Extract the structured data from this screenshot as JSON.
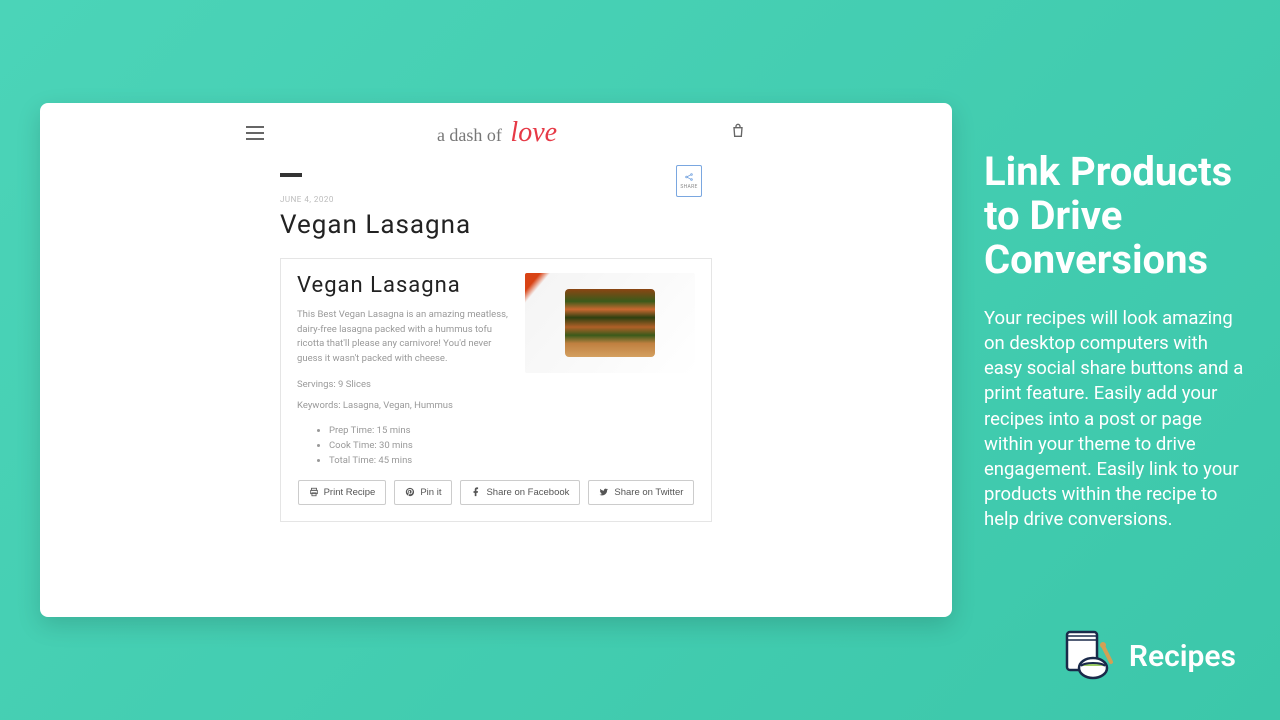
{
  "site": {
    "logo_prefix": "a dash of",
    "logo_accent": "love"
  },
  "post": {
    "date": "JUNE 4, 2020",
    "title": "Vegan Lasagna",
    "share_label": "SHARE"
  },
  "recipe": {
    "title": "Vegan Lasagna",
    "description": "This Best Vegan Lasagna is an amazing meatless, dairy-free lasagna packed with a hummus tofu ricotta that'll please any carnivore! You'd never guess it wasn't packed with cheese.",
    "servings": "Servings: 9 Slices",
    "keywords": "Keywords: Lasagna, Vegan, Hummus",
    "times": [
      "Prep Time: 15 mins",
      "Cook Time: 30 mins",
      "Total Time: 45 mins"
    ],
    "buttons": {
      "print": "Print Recipe",
      "pin": "Pin it",
      "facebook": "Share on Facebook",
      "twitter": "Share on Twitter"
    }
  },
  "promo": {
    "title": "Link Products to Drive Conversions",
    "body": "Your recipes will look amazing on desktop computers with easy social share buttons and a print feature. Easily add your recipes into a post or page within your theme to drive engagement. Easily link to your products within the recipe to help drive conversions."
  },
  "brand": {
    "name": "Recipes"
  }
}
